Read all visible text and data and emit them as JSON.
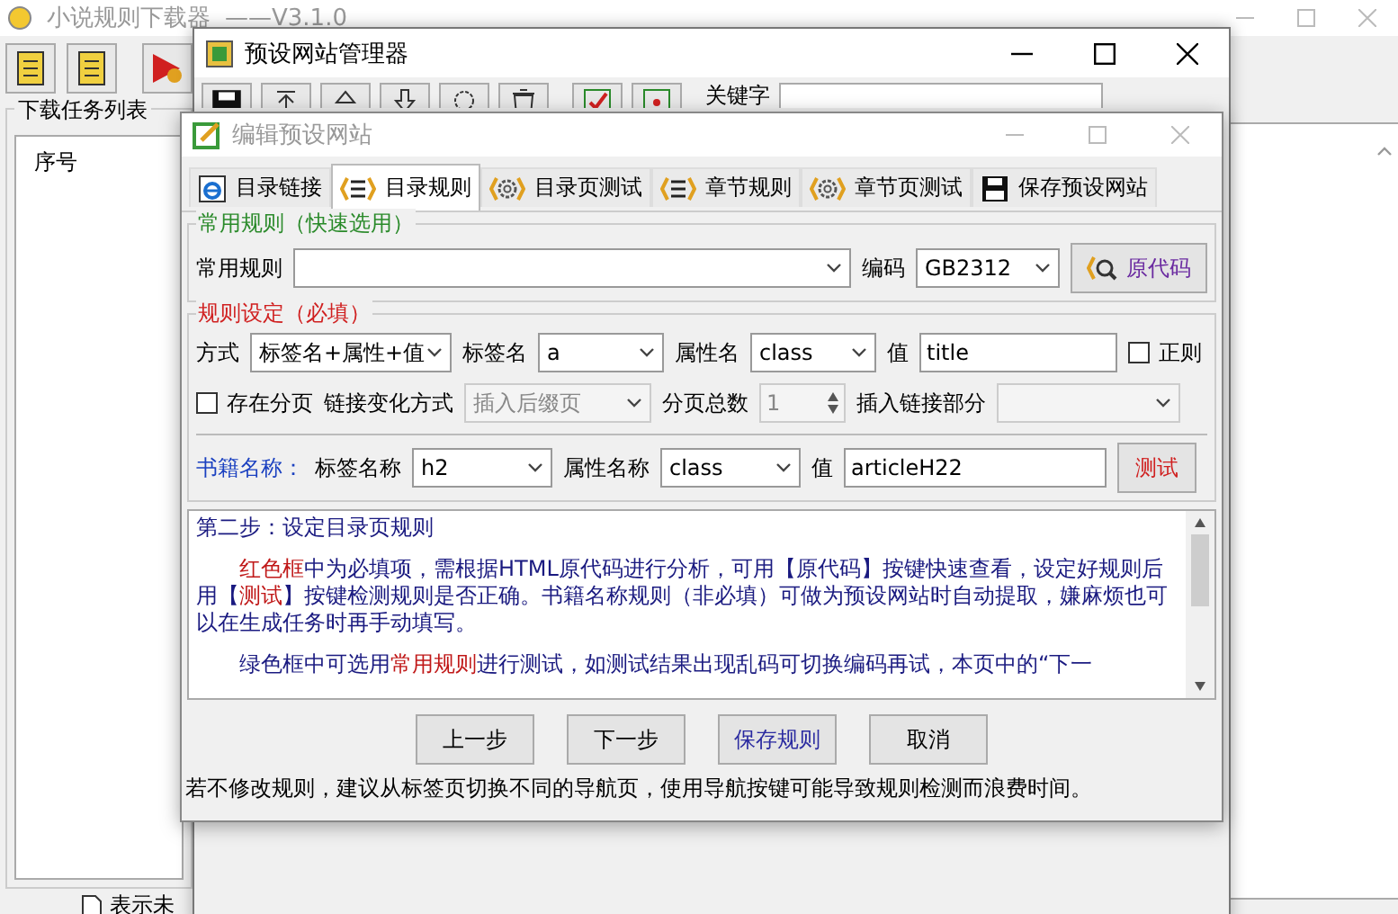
{
  "main_window": {
    "title": "小说规则下载器",
    "version": "——V3.1.0",
    "task_group": "下载任务列表",
    "list_header": "序号",
    "status": "表示未"
  },
  "manager_window": {
    "title": "预设网站管理器",
    "keyword_label": "关键字"
  },
  "dialog": {
    "title": "编辑预设网站",
    "tabs": [
      {
        "label": "目录链接",
        "selected": false
      },
      {
        "label": "目录规则",
        "selected": true
      },
      {
        "label": "目录页测试",
        "selected": false
      },
      {
        "label": "章节规则",
        "selected": false
      },
      {
        "label": "章节页测试",
        "selected": false
      },
      {
        "label": "保存预设网站",
        "selected": false
      }
    ],
    "common_group": {
      "title": "常用规则（快速选用）",
      "rule_label": "常用规则",
      "encoding_label": "编码",
      "encoding": "GB2312",
      "source_button": "原代码"
    },
    "rule_group": {
      "title": "规则设定（必填）",
      "row1": [
        {
          "label": "方式",
          "value": "标签名+属性+值"
        },
        {
          "label": "标签名",
          "value": "a"
        },
        {
          "label": "属性名",
          "value": "class"
        }
      ],
      "value_label": "值",
      "value": "title",
      "regex": {
        "label": "正则",
        "checked": false
      },
      "paging": {
        "label": "存在分页",
        "checked": false
      },
      "link_mode_label": "链接变化方式",
      "link_mode": "插入后缀页",
      "link_mode_disabled": true,
      "page_total_label": "分页总数",
      "page_total": "1",
      "insert_label": "插入链接部分",
      "book_label": "书籍名称：",
      "row3": [
        {
          "label": "标签名称",
          "value": "h2"
        },
        {
          "label": "属性名称",
          "value": "class"
        }
      ],
      "book_value_label": "值",
      "book_value": "articleH22",
      "test_button": "测试"
    },
    "help": [
      [
        {
          "text": "第二步：设定目录页规则",
          "highlight": false
        }
      ],
      [
        {
          "text": "红色框",
          "highlight": true
        },
        {
          "text": "中为必填项，需根据HTML原代码进行分析，可用【原代码】按键快速查看，设定好规则后用【",
          "highlight": false
        },
        {
          "text": "测试",
          "highlight": true
        },
        {
          "text": "】按键检测规则是否正确。书籍名称规则（非必填）可做为预设网站时自动提取，嫌麻烦也可以在生成任务时再手动填写。",
          "highlight": false
        }
      ],
      [
        {
          "text": "绿色框中可选用",
          "highlight": false
        },
        {
          "text": "常用规则",
          "highlight": true
        },
        {
          "text": "进行测试，如测试结果出现乱码可切换编码再试，本页中的“下一",
          "highlight": false
        }
      ]
    ],
    "buttons": [
      {
        "label": "上一步",
        "primary": false
      },
      {
        "label": "下一步",
        "primary": false
      },
      {
        "label": "保存规则",
        "primary": true
      },
      {
        "label": "取消",
        "primary": false
      }
    ],
    "status": "若不修改规则，建议从标签页切换不同的导航页，使用导航按键可能导致规则检测而浪费时间。"
  }
}
